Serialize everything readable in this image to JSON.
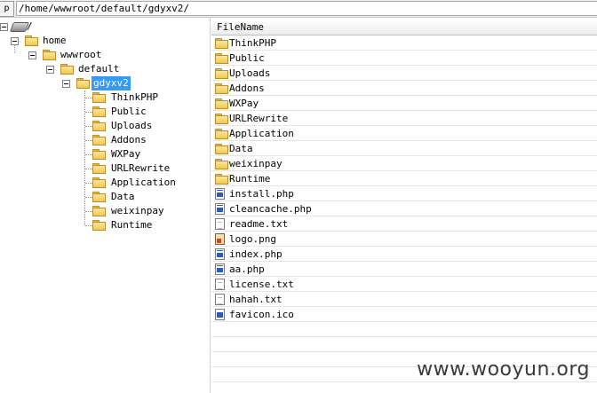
{
  "toolbar": {
    "up_label": "Up"
  },
  "address": {
    "path": "/home/wwwroot/default/gdyxv2/"
  },
  "tree": {
    "root": "/",
    "home": "home",
    "wwwroot": "wwwroot",
    "default": "default",
    "selected": "gdyxv2",
    "children": [
      "ThinkPHP",
      "Public",
      "Uploads",
      "Addons",
      "WXPay",
      "URLRewrite",
      "Application",
      "Data",
      "weixinpay",
      "Runtime"
    ]
  },
  "list": {
    "column_header": "FileName",
    "items": [
      {
        "name": "ThinkPHP",
        "icon": "folder-icon"
      },
      {
        "name": "Public",
        "icon": "folder-icon"
      },
      {
        "name": "Uploads",
        "icon": "folder-icon"
      },
      {
        "name": "Addons",
        "icon": "folder-icon"
      },
      {
        "name": "WXPay",
        "icon": "folder-icon"
      },
      {
        "name": "URLRewrite",
        "icon": "folder-icon"
      },
      {
        "name": "Application",
        "icon": "folder-icon"
      },
      {
        "name": "Data",
        "icon": "folder-icon"
      },
      {
        "name": "weixinpay",
        "icon": "folder-icon"
      },
      {
        "name": "Runtime",
        "icon": "folder-icon"
      },
      {
        "name": "install.php",
        "icon": "php-file-icon"
      },
      {
        "name": "cleancache.php",
        "icon": "php-file-icon"
      },
      {
        "name": "readme.txt",
        "icon": "text-file-icon"
      },
      {
        "name": "logo.png",
        "icon": "image-file-icon"
      },
      {
        "name": "index.php",
        "icon": "php-file-icon"
      },
      {
        "name": "aa.php",
        "icon": "php-file-icon"
      },
      {
        "name": "license.txt",
        "icon": "text-file-icon"
      },
      {
        "name": "hahah.txt",
        "icon": "text-file-icon"
      },
      {
        "name": "favicon.ico",
        "icon": "ico-file-icon"
      }
    ]
  },
  "watermark": "www.wooyun.org",
  "colors": {
    "selection": "#3399ff",
    "folder": "#f0c84e"
  }
}
